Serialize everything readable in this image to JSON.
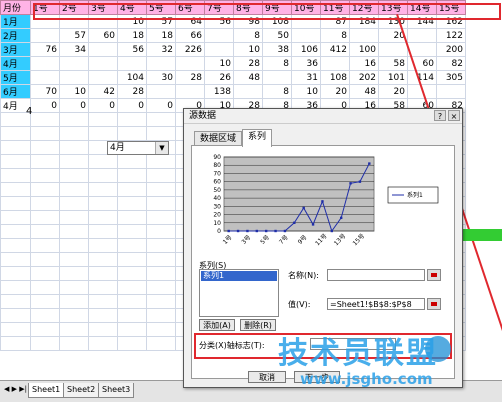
{
  "sheet": {
    "header": [
      "月份",
      "1号",
      "2号",
      "3号",
      "4号",
      "5号",
      "6号",
      "7号",
      "8号",
      "9号",
      "10号",
      "11号",
      "12号",
      "13号",
      "14号",
      "15号"
    ],
    "rows": [
      [
        "1月",
        "",
        "",
        "",
        "10",
        "57",
        "64",
        "56",
        "98",
        "108",
        "",
        "87",
        "184",
        "130",
        "144",
        "162"
      ],
      [
        "2月",
        "",
        "57",
        "60",
        "18",
        "18",
        "66",
        "",
        "8",
        "50",
        "",
        "8",
        "",
        "20",
        "",
        "122"
      ],
      [
        "3月",
        "76",
        "34",
        "",
        "56",
        "32",
        "226",
        "",
        "10",
        "38",
        "106",
        "412",
        "100",
        "",
        "",
        "200"
      ],
      [
        "4月",
        "",
        "",
        "",
        "",
        "",
        "",
        "10",
        "28",
        "8",
        "36",
        "",
        "16",
        "58",
        "60",
        "82"
      ],
      [
        "5月",
        "",
        "",
        "",
        "104",
        "30",
        "28",
        "26",
        "48",
        "",
        "31",
        "108",
        "202",
        "101",
        "114",
        "305"
      ],
      [
        "6月",
        "70",
        "10",
        "42",
        "28",
        "",
        "",
        "138",
        "",
        "8",
        "10",
        "20",
        "48",
        "20",
        "",
        ""
      ],
      [
        "4月",
        "0",
        "0",
        "0",
        "0",
        "0",
        "0",
        "10",
        "28",
        "8",
        "36",
        "0",
        "16",
        "58",
        "60",
        "82"
      ]
    ],
    "extra_value": "4",
    "dropdown_value": "4月"
  },
  "dialog": {
    "title": "源数据",
    "tabs": [
      "数据区域",
      "系列"
    ],
    "series_label": "系列(S)",
    "series_items": [
      "系列1"
    ],
    "add_label": "添加(A)",
    "delete_label": "删除(R)",
    "name_label": "名称(N):",
    "name_value": "",
    "value_label": "值(V):",
    "value_value": "=Sheet1!$B$8:$P$8",
    "category_label": "分类(X)轴标志(T):",
    "cancel_label": "取消",
    "next_label": "下一步",
    "help_label": "?",
    "close_label": "×"
  },
  "chart_data": {
    "type": "line",
    "y_ticks": [
      "0",
      "10",
      "20",
      "30",
      "40",
      "50",
      "60",
      "70",
      "80",
      "90"
    ],
    "ylim": [
      0,
      90
    ],
    "x": [
      "1号",
      "2号",
      "3号",
      "4号",
      "5号",
      "6号",
      "7号",
      "8号",
      "9号",
      "10号",
      "11号",
      "12号",
      "13号",
      "14号",
      "15号"
    ],
    "x_tick_labels": [
      "1号",
      "3号",
      "5号",
      "7号",
      "9号",
      "11号",
      "13号",
      "15号"
    ],
    "series": [
      {
        "name": "系列1",
        "values": [
          0,
          0,
          0,
          0,
          0,
          0,
          0,
          10,
          28,
          8,
          36,
          0,
          16,
          58,
          60,
          82
        ]
      }
    ],
    "legend": "right",
    "grid": true
  },
  "sheet_tabs": [
    "Sheet1",
    "Sheet2",
    "Sheet3"
  ],
  "watermark": {
    "title": "技术员联盟",
    "url": "www.jsgho.com"
  },
  "colors": {
    "header_pink": "#ffb3e6",
    "month_cyan": "#33ccff",
    "highlight_red": "#e0282e",
    "series_blue": "#1f2ea8",
    "plot_gray": "#c0c0c0"
  }
}
